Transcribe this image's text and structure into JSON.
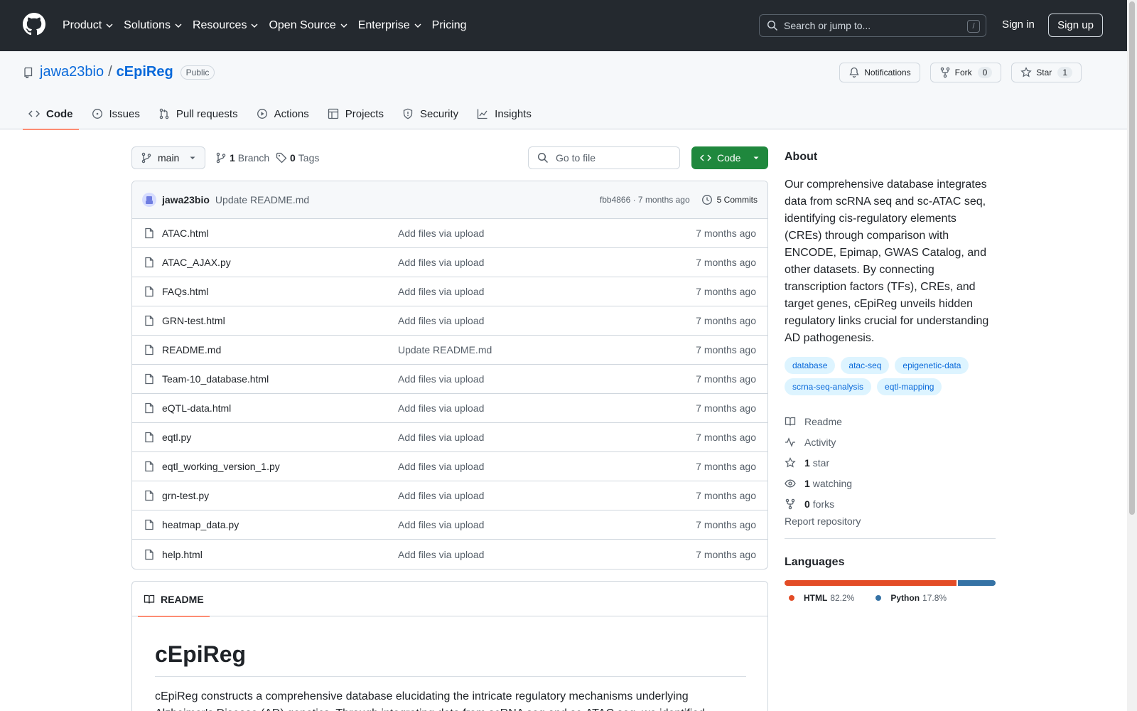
{
  "header": {
    "nav": [
      "Product",
      "Solutions",
      "Resources",
      "Open Source",
      "Enterprise",
      "Pricing"
    ],
    "search_placeholder": "Search or jump to...",
    "search_shortcut": "/",
    "sign_in": "Sign in",
    "sign_up": "Sign up"
  },
  "repo": {
    "owner": "jawa23bio",
    "separator": "/",
    "name": "cEpiReg",
    "visibility": "Public",
    "notifications_label": "Notifications",
    "fork_label": "Fork",
    "fork_count": "0",
    "star_label": "Star",
    "star_count": "1"
  },
  "tabs": [
    {
      "label": "Code",
      "icon": "code-icon"
    },
    {
      "label": "Issues",
      "icon": "issue-icon"
    },
    {
      "label": "Pull requests",
      "icon": "pull-request-icon"
    },
    {
      "label": "Actions",
      "icon": "play-icon"
    },
    {
      "label": "Projects",
      "icon": "table-icon"
    },
    {
      "label": "Security",
      "icon": "shield-icon"
    },
    {
      "label": "Insights",
      "icon": "graph-icon"
    }
  ],
  "branchbar": {
    "branch": "main",
    "branch_count": "1",
    "branch_label": "Branch",
    "tag_count": "0",
    "tag_label": "Tags",
    "goto_placeholder": "Go to file",
    "code_label": "Code"
  },
  "commit": {
    "author": "jawa23bio",
    "message": "Update README.md",
    "hash_time": "fbb4866 · 7 months ago",
    "commits_label": "5 Commits"
  },
  "files": [
    {
      "name": "ATAC.html",
      "message": "Add files via upload",
      "date": "7 months ago"
    },
    {
      "name": "ATAC_AJAX.py",
      "message": "Add files via upload",
      "date": "7 months ago"
    },
    {
      "name": "FAQs.html",
      "message": "Add files via upload",
      "date": "7 months ago"
    },
    {
      "name": "GRN-test.html",
      "message": "Add files via upload",
      "date": "7 months ago"
    },
    {
      "name": "README.md",
      "message": "Update README.md",
      "date": "7 months ago"
    },
    {
      "name": "Team-10_database.html",
      "message": "Add files via upload",
      "date": "7 months ago"
    },
    {
      "name": "eQTL-data.html",
      "message": "Add files via upload",
      "date": "7 months ago"
    },
    {
      "name": "eqtl.py",
      "message": "Add files via upload",
      "date": "7 months ago"
    },
    {
      "name": "eqtl_working_version_1.py",
      "message": "Add files via upload",
      "date": "7 months ago"
    },
    {
      "name": "grn-test.py",
      "message": "Add files via upload",
      "date": "7 months ago"
    },
    {
      "name": "heatmap_data.py",
      "message": "Add files via upload",
      "date": "7 months ago"
    },
    {
      "name": "help.html",
      "message": "Add files via upload",
      "date": "7 months ago"
    }
  ],
  "readme": {
    "tab_label": "README",
    "title": "cEpiReg",
    "body": "cEpiReg constructs a comprehensive database elucidating the intricate regulatory mechanisms underlying Alzheimer's Disease (AD) genetics. Through integrating data from scRNA seq and sc-ATAC seq, we identified the"
  },
  "sidebar": {
    "about_title": "About",
    "about_text": "Our comprehensive database integrates data from scRNA seq and sc-ATAC seq, identifying cis-regulatory elements (CREs) through comparison with ENCODE, Epimap, GWAS Catalog, and other datasets. By connecting transcription factors (TFs), CREs, and target genes, cEpiReg unveils hidden regulatory links crucial for understanding AD pathogenesis.",
    "topics": [
      "database",
      "atac-seq",
      "epigenetic-data",
      "scrna-seq-analysis",
      "eqtl-mapping"
    ],
    "readme_label": "Readme",
    "activity_label": "Activity",
    "stars_count": "1",
    "stars_label": "star",
    "watching_count": "1",
    "watching_label": "watching",
    "forks_count": "0",
    "forks_label": "forks",
    "report_label": "Report repository",
    "languages_title": "Languages",
    "languages": [
      {
        "name": "HTML",
        "percent": "82.2%",
        "value": 82.2,
        "color": "#e34c26"
      },
      {
        "name": "Python",
        "percent": "17.8%",
        "value": 17.8,
        "color": "#3572a5"
      }
    ]
  }
}
